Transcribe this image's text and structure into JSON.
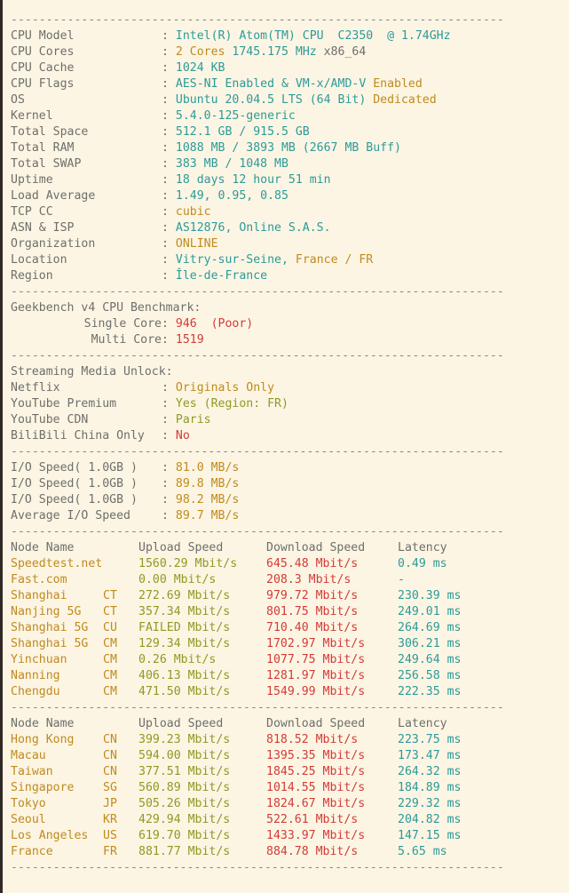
{
  "separator": "----------------------------------------------------------------------",
  "system": {
    "rows": [
      {
        "label": "CPU Model",
        "parts": [
          {
            "t": "Intel(R) Atom(TM) CPU  C2350  @ 1.74GHz",
            "c": "c-cyan"
          }
        ]
      },
      {
        "label": "CPU Cores",
        "parts": [
          {
            "t": "2 Cores ",
            "c": "c-orange"
          },
          {
            "t": "1745.175 MHz ",
            "c": "c-cyan"
          },
          {
            "t": "x86_64",
            "c": "c-label"
          }
        ]
      },
      {
        "label": "CPU Cache",
        "parts": [
          {
            "t": "1024 KB",
            "c": "c-cyan"
          }
        ]
      },
      {
        "label": "CPU Flags",
        "parts": [
          {
            "t": "AES-NI Enabled & VM-x/AMD-V ",
            "c": "c-cyan"
          },
          {
            "t": "Enabled",
            "c": "c-orange"
          }
        ]
      },
      {
        "label": "OS",
        "parts": [
          {
            "t": "Ubuntu 20.04.5 LTS (64 Bit) ",
            "c": "c-cyan"
          },
          {
            "t": "Dedicated",
            "c": "c-orange"
          }
        ]
      },
      {
        "label": "Kernel",
        "parts": [
          {
            "t": "5.4.0-125-generic",
            "c": "c-cyan"
          }
        ]
      },
      {
        "label": "Total Space",
        "parts": [
          {
            "t": "512.1 GB / 915.5 GB",
            "c": "c-cyan"
          }
        ]
      },
      {
        "label": "Total RAM",
        "parts": [
          {
            "t": "1088 MB / 3893 MB (2667 MB Buff)",
            "c": "c-cyan"
          }
        ]
      },
      {
        "label": "Total SWAP",
        "parts": [
          {
            "t": "383 MB / 1048 MB",
            "c": "c-cyan"
          }
        ]
      },
      {
        "label": "Uptime",
        "parts": [
          {
            "t": "18 days 12 hour 51 min",
            "c": "c-cyan"
          }
        ]
      },
      {
        "label": "Load Average",
        "parts": [
          {
            "t": "1.49, 0.95, 0.85",
            "c": "c-cyan"
          }
        ]
      },
      {
        "label": "TCP CC",
        "parts": [
          {
            "t": "cubic",
            "c": "c-orange"
          }
        ]
      },
      {
        "label": "ASN & ISP",
        "parts": [
          {
            "t": "AS12876, Online S.A.S.",
            "c": "c-cyan"
          }
        ]
      },
      {
        "label": "Organization",
        "parts": [
          {
            "t": "ONLINE",
            "c": "c-orange"
          }
        ]
      },
      {
        "label": "Location",
        "parts": [
          {
            "t": "Vitry-sur-Seine, ",
            "c": "c-cyan"
          },
          {
            "t": "France / FR",
            "c": "c-orange"
          }
        ]
      },
      {
        "label": "Region",
        "parts": [
          {
            "t": "Île-de-France",
            "c": "c-cyan"
          }
        ]
      }
    ]
  },
  "geekbench": {
    "title": "Geekbench v4 CPU Benchmark:",
    "rows": [
      {
        "label": "Single Core",
        "parts": [
          {
            "t": "946  (Poor)",
            "c": "c-red"
          }
        ]
      },
      {
        "label": "Multi Core",
        "parts": [
          {
            "t": "1519",
            "c": "c-red"
          }
        ]
      }
    ]
  },
  "streaming": {
    "title": "Streaming Media Unlock:",
    "rows": [
      {
        "label": "Netflix",
        "parts": [
          {
            "t": "Originals Only",
            "c": "c-orange"
          }
        ]
      },
      {
        "label": "YouTube Premium",
        "parts": [
          {
            "t": "Yes (Region: FR)",
            "c": "c-olive"
          }
        ]
      },
      {
        "label": "YouTube CDN",
        "parts": [
          {
            "t": "Paris",
            "c": "c-olive"
          }
        ]
      },
      {
        "label": "BiliBili China Only",
        "parts": [
          {
            "t": "No",
            "c": "c-red"
          }
        ]
      }
    ]
  },
  "io": {
    "rows": [
      {
        "label": "I/O Speed( 1.0GB )",
        "parts": [
          {
            "t": "81.0 MB/s",
            "c": "c-orange"
          }
        ]
      },
      {
        "label": "I/O Speed( 1.0GB )",
        "parts": [
          {
            "t": "89.8 MB/s",
            "c": "c-orange"
          }
        ]
      },
      {
        "label": "I/O Speed( 1.0GB )",
        "parts": [
          {
            "t": "98.2 MB/s",
            "c": "c-orange"
          }
        ]
      },
      {
        "label": "Average I/O Speed",
        "parts": [
          {
            "t": "89.7 MB/s",
            "c": "c-orange"
          }
        ]
      }
    ]
  },
  "speedtest_cn": {
    "headers": {
      "name": "Node Name",
      "cc": "",
      "upload": "Upload Speed",
      "download": "Download Speed",
      "latency": "Latency"
    },
    "rows": [
      {
        "name": "Speedtest.net",
        "cc": "",
        "upload": "1560.29 Mbit/s",
        "download": "645.48 Mbit/s",
        "latency": "0.49 ms"
      },
      {
        "name": "Fast.com",
        "cc": "",
        "upload": "0.00 Mbit/s",
        "download": "208.3 Mbit/s",
        "latency": "-"
      },
      {
        "name": "Shanghai",
        "cc": "CT",
        "upload": "272.69 Mbit/s",
        "download": "979.72 Mbit/s",
        "latency": "230.39 ms"
      },
      {
        "name": "Nanjing 5G",
        "cc": "CT",
        "upload": "357.34 Mbit/s",
        "download": "801.75 Mbit/s",
        "latency": "249.01 ms"
      },
      {
        "name": "Shanghai 5G",
        "cc": "CU",
        "upload": "FAILED Mbit/s",
        "download": "710.40 Mbit/s",
        "latency": "264.69 ms"
      },
      {
        "name": "Shanghai 5G",
        "cc": "CM",
        "upload": "129.34 Mbit/s",
        "download": "1702.97 Mbit/s",
        "latency": "306.21 ms"
      },
      {
        "name": "Yinchuan",
        "cc": "CM",
        "upload": "0.26 Mbit/s",
        "download": "1077.75 Mbit/s",
        "latency": "249.64 ms"
      },
      {
        "name": "Nanning",
        "cc": "CM",
        "upload": "406.13 Mbit/s",
        "download": "1281.97 Mbit/s",
        "latency": "256.58 ms"
      },
      {
        "name": "Chengdu",
        "cc": "CM",
        "upload": "471.50 Mbit/s",
        "download": "1549.99 Mbit/s",
        "latency": "222.35 ms"
      }
    ]
  },
  "speedtest_intl": {
    "headers": {
      "name": "Node Name",
      "cc": "",
      "upload": "Upload Speed",
      "download": "Download Speed",
      "latency": "Latency"
    },
    "rows": [
      {
        "name": "Hong Kong",
        "cc": "CN",
        "upload": "399.23 Mbit/s",
        "download": "818.52 Mbit/s",
        "latency": "223.75 ms"
      },
      {
        "name": "Macau",
        "cc": "CN",
        "upload": "594.00 Mbit/s",
        "download": "1395.35 Mbit/s",
        "latency": "173.47 ms"
      },
      {
        "name": "Taiwan",
        "cc": "CN",
        "upload": "377.51 Mbit/s",
        "download": "1845.25 Mbit/s",
        "latency": "264.32 ms"
      },
      {
        "name": "Singapore",
        "cc": "SG",
        "upload": "560.89 Mbit/s",
        "download": "1014.55 Mbit/s",
        "latency": "184.89 ms"
      },
      {
        "name": "Tokyo",
        "cc": "JP",
        "upload": "505.26 Mbit/s",
        "download": "1824.67 Mbit/s",
        "latency": "229.32 ms"
      },
      {
        "name": "Seoul",
        "cc": "KR",
        "upload": "429.94 Mbit/s",
        "download": "522.61 Mbit/s",
        "latency": "204.82 ms"
      },
      {
        "name": "Los Angeles",
        "cc": "US",
        "upload": "619.70 Mbit/s",
        "download": "1433.97 Mbit/s",
        "latency": "147.15 ms"
      },
      {
        "name": "France",
        "cc": "FR",
        "upload": "881.77 Mbit/s",
        "download": "884.78 Mbit/s",
        "latency": "5.65 ms"
      }
    ]
  },
  "colors": {
    "background": "#fcf5e3",
    "label": "#6d6f6c",
    "cyan": "#2c9a9a",
    "orange": "#c08a1e",
    "olive": "#8d9b24",
    "red": "#d33b38",
    "separator": "#7f8b8c"
  }
}
